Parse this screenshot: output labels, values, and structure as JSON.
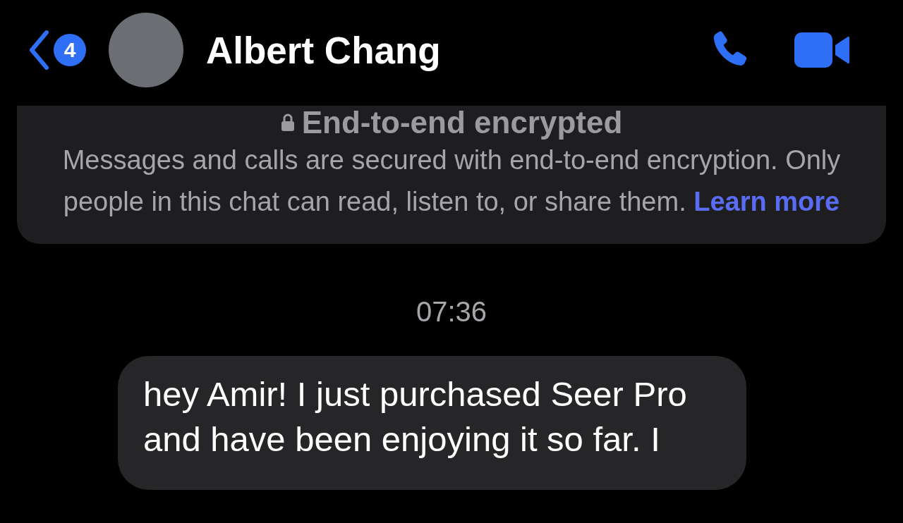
{
  "header": {
    "back_badge": "4",
    "contact_name": "Albert Chang"
  },
  "notice": {
    "title": "End-to-end encrypted",
    "body": "Messages and calls are secured with end-to-end encryption. Only people in this chat can read, listen to, or share them.",
    "link": "Learn more"
  },
  "messages": [
    {
      "kind": "timestamp",
      "text": "07:36"
    },
    {
      "kind": "incoming",
      "text": "hey Amir! I just purchased Seer Pro and have been enjoying it so far. I"
    }
  ]
}
